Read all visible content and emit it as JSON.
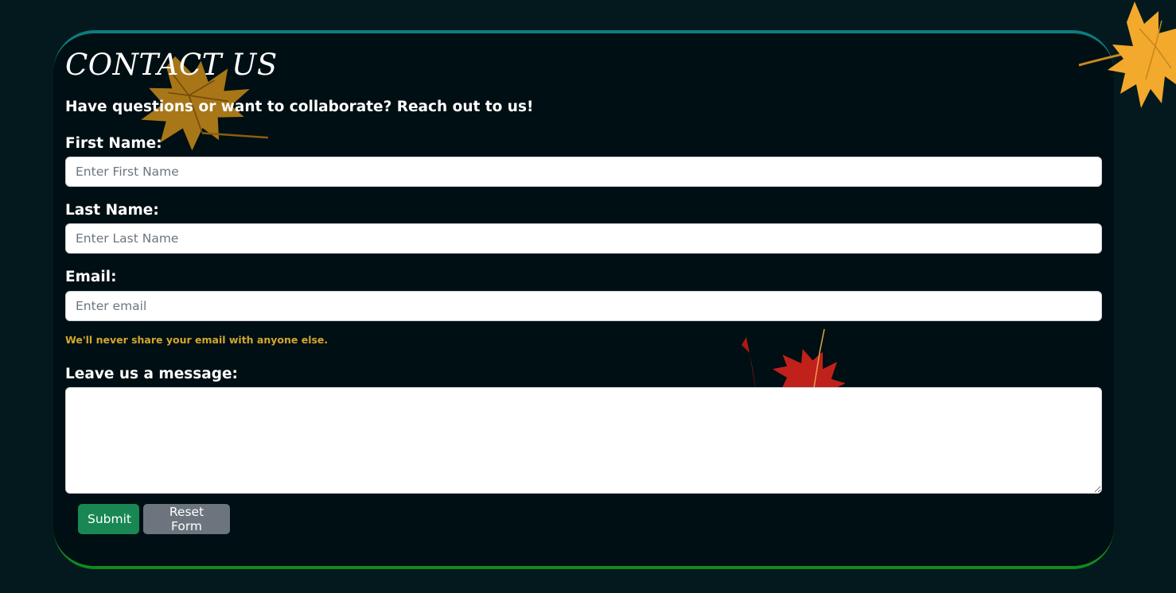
{
  "header": {
    "title": "CONTACT US",
    "subtitle": "Have questions or want to collaborate? Reach out to us!"
  },
  "form": {
    "first_name": {
      "label": "First Name:",
      "placeholder": "Enter First Name",
      "value": ""
    },
    "last_name": {
      "label": "Last Name:",
      "placeholder": "Enter Last Name",
      "value": ""
    },
    "email": {
      "label": "Email:",
      "placeholder": "Enter email",
      "value": "",
      "help": "We'll never share your email with anyone else."
    },
    "message": {
      "label": "Leave us a message:",
      "value": ""
    },
    "submit_label": "Submit",
    "reset_label": "Reset Form"
  },
  "colors": {
    "page_background": "#03191e",
    "card_background": "#000f13",
    "card_top_border": "#0c7d80",
    "card_bottom_border": "#118a1e",
    "help_text": "#d4a72c",
    "submit_button": "#198754",
    "reset_button": "#6c757d"
  },
  "decorations": [
    "yellow-maple-leaf-icon",
    "red-maple-leaf-icon",
    "yellow-maple-leaf-icon"
  ]
}
